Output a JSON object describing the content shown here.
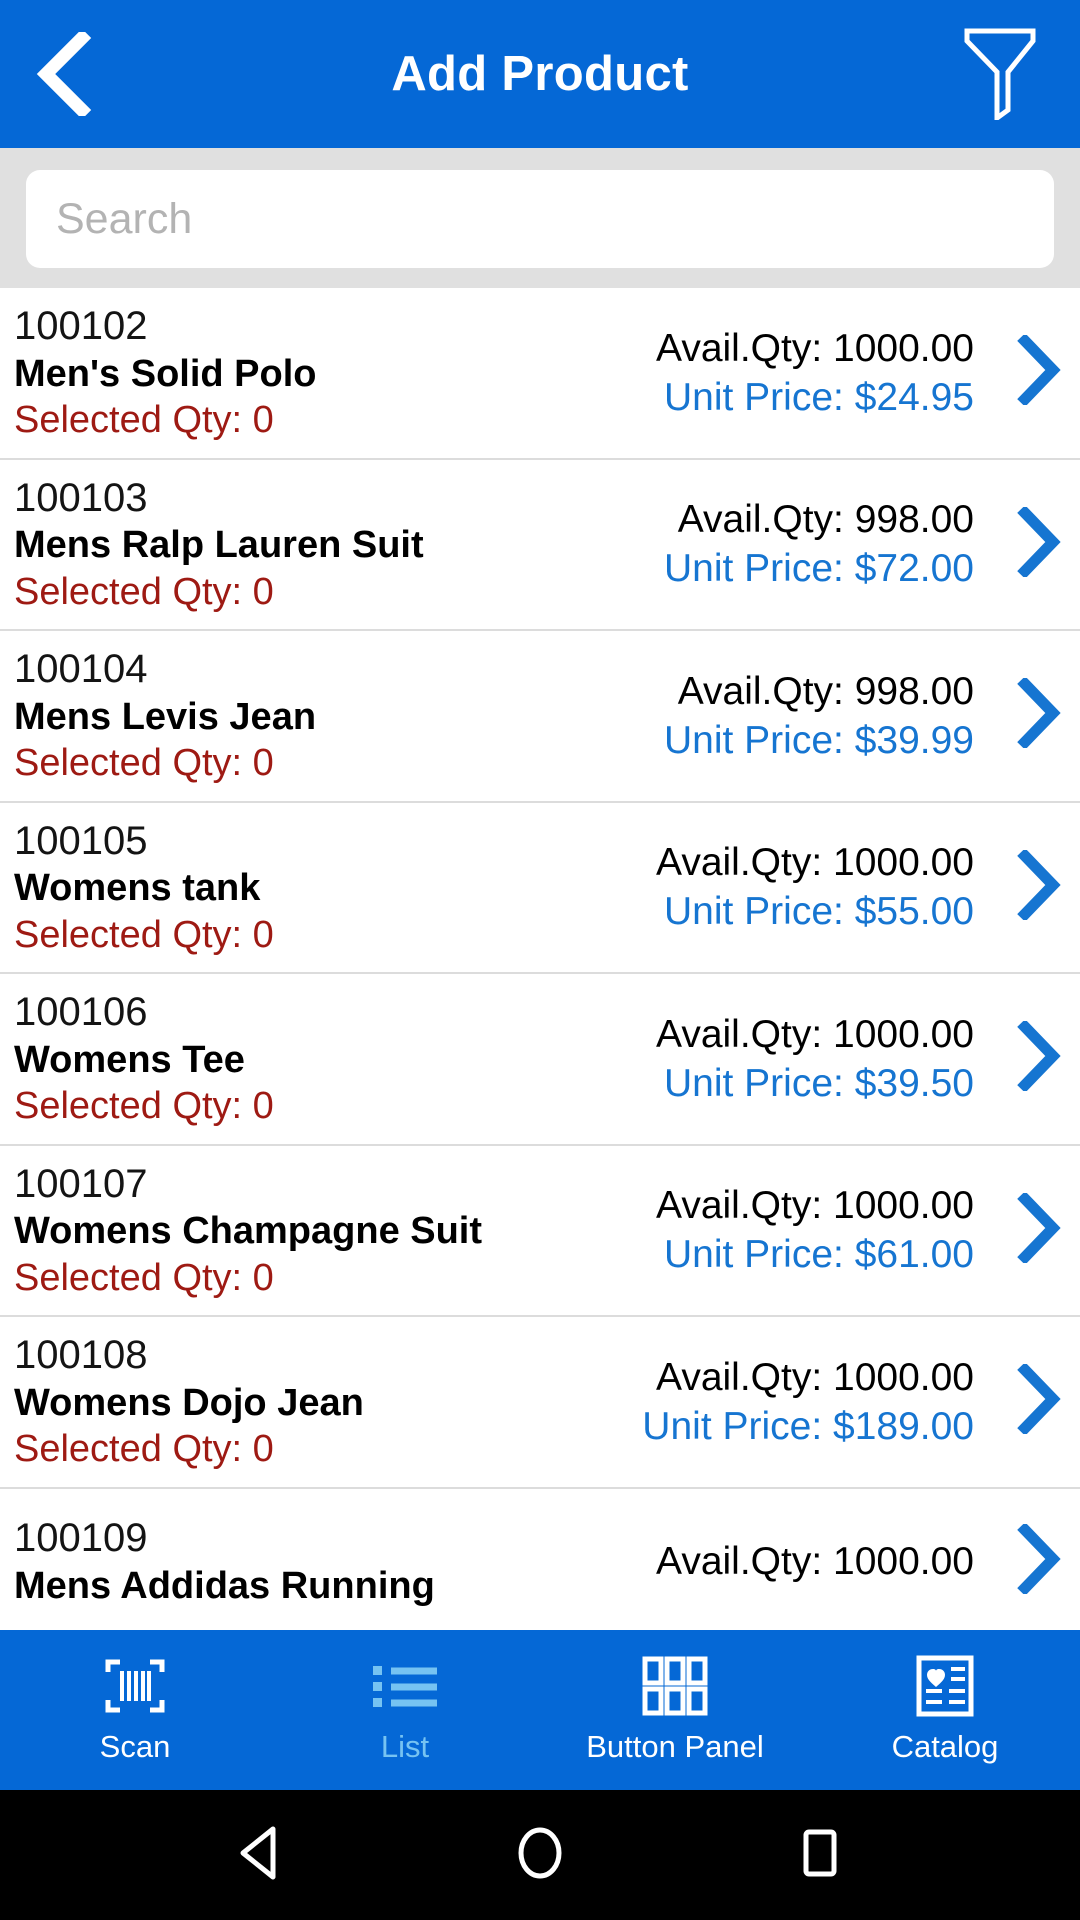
{
  "theme": {
    "header_blue": "#0568d6",
    "price_blue": "#1675d1",
    "selected_qty_red": "#9e1a13",
    "tab_dim_blue": "#76c3f2",
    "search_strip_gray": "#e0e0e0"
  },
  "header": {
    "title": "Add Product",
    "back_icon": "chevron-left-icon",
    "filter_icon": "filter-funnel-icon"
  },
  "search": {
    "placeholder": "Search",
    "value": ""
  },
  "labels": {
    "avail_prefix": "Avail.Qty: ",
    "price_prefix": "Unit Price: ",
    "selected_prefix": "Selected Qty: "
  },
  "products": [
    {
      "sku": "100102",
      "name": "Men's Solid Polo",
      "selected_qty": "Selected Qty: 0",
      "avail_qty": "Avail.Qty: 1000.00",
      "unit_price": "Unit Price: $24.95"
    },
    {
      "sku": "100103",
      "name": "Mens Ralp Lauren Suit",
      "selected_qty": "Selected Qty: 0",
      "avail_qty": "Avail.Qty: 998.00",
      "unit_price": "Unit Price: $72.00"
    },
    {
      "sku": "100104",
      "name": "Mens Levis Jean",
      "selected_qty": "Selected Qty: 0",
      "avail_qty": "Avail.Qty: 998.00",
      "unit_price": "Unit Price: $39.99"
    },
    {
      "sku": "100105",
      "name": "Womens tank",
      "selected_qty": "Selected Qty: 0",
      "avail_qty": "Avail.Qty: 1000.00",
      "unit_price": "Unit Price: $55.00"
    },
    {
      "sku": "100106",
      "name": "Womens Tee",
      "selected_qty": "Selected Qty: 0",
      "avail_qty": "Avail.Qty: 1000.00",
      "unit_price": "Unit Price: $39.50"
    },
    {
      "sku": "100107",
      "name": "Womens Champagne Suit",
      "selected_qty": "Selected Qty: 0",
      "avail_qty": "Avail.Qty: 1000.00",
      "unit_price": "Unit Price: $61.00"
    },
    {
      "sku": "100108",
      "name": "Womens Dojo Jean",
      "selected_qty": "Selected Qty: 0",
      "avail_qty": "Avail.Qty: 1000.00",
      "unit_price": "Unit Price: $189.00"
    },
    {
      "sku": "100109",
      "name": "Mens Addidas Running",
      "selected_qty": "",
      "avail_qty": "Avail.Qty: 1000.00",
      "unit_price": ""
    }
  ],
  "tabbar": {
    "items": [
      {
        "label": "Scan",
        "icon": "barcode-scan-icon",
        "dim": false
      },
      {
        "label": "List",
        "icon": "list-bullet-icon",
        "dim": true
      },
      {
        "label": "Button Panel",
        "icon": "grid-panel-icon",
        "dim": false
      },
      {
        "label": "Catalog",
        "icon": "catalog-heart-icon",
        "dim": false
      }
    ]
  },
  "navbar": {
    "back": "android-back-icon",
    "home": "android-home-icon",
    "recents": "android-recents-icon"
  }
}
